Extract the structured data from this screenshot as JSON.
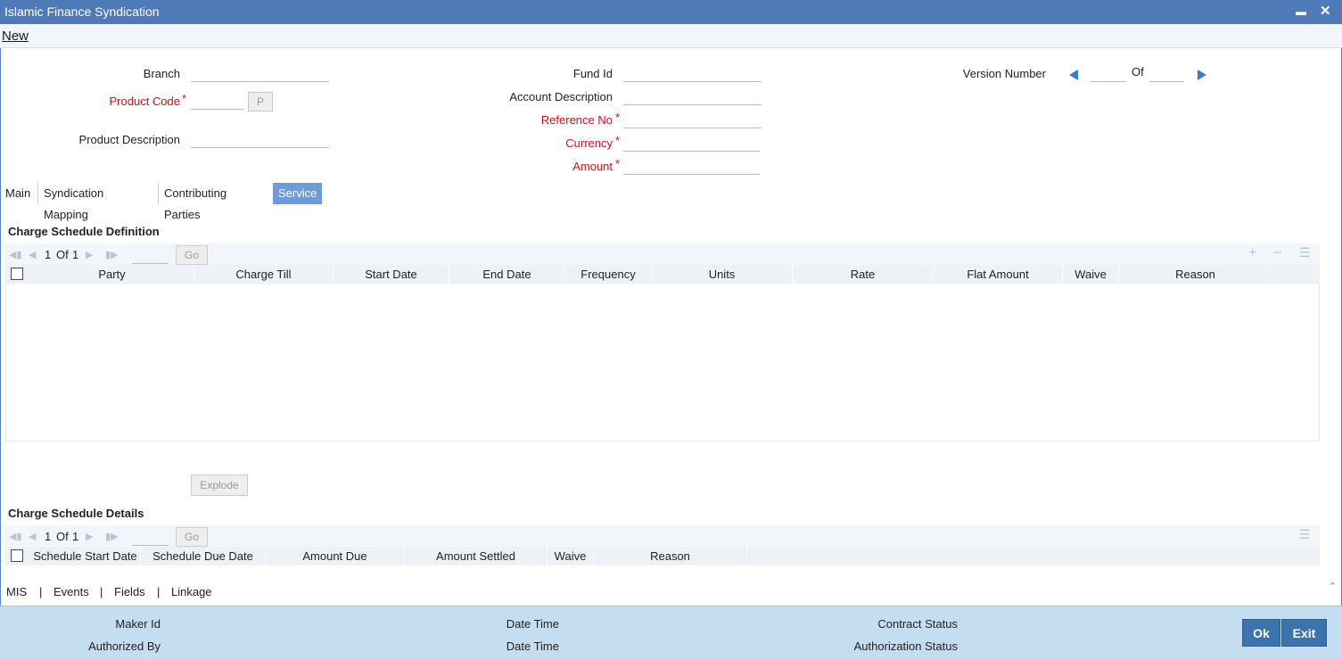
{
  "window": {
    "title": "Islamic Finance Syndication",
    "minimize_glyph": "▬",
    "close_glyph": "✕"
  },
  "menu": {
    "new_label": "New"
  },
  "header": {
    "branch_label": "Branch",
    "product_code_label": "Product Code",
    "product_code_button": "P",
    "product_description_label": "Product Description",
    "fund_id_label": "Fund Id",
    "account_description_label": "Account Description",
    "reference_no_label": "Reference No",
    "currency_label": "Currency",
    "amount_label": "Amount",
    "version_number_label": "Version Number",
    "version_of_label": "Of",
    "required_marker": "*"
  },
  "tabs": [
    "Main",
    "Syndication Mapping",
    "Contributing Parties",
    "Service Charge"
  ],
  "charge_schedule_definition": {
    "title": "Charge Schedule Definition",
    "pager": {
      "current": "1",
      "of_label": "Of",
      "total": "1",
      "go_label": "Go"
    },
    "columns": [
      "Party",
      "Charge Till",
      "Start Date",
      "End Date",
      "Frequency",
      "Units",
      "Rate",
      "Flat Amount",
      "Waive",
      "Reason"
    ],
    "rows": []
  },
  "explode_label": "Explode",
  "charge_schedule_details": {
    "title": "Charge Schedule Details",
    "pager": {
      "current": "1",
      "of_label": "Of",
      "total": "1",
      "go_label": "Go"
    },
    "columns": [
      "Schedule Start Date",
      "Schedule Due Date",
      "Amount Due",
      "Amount Settled",
      "Waive",
      "Reason"
    ]
  },
  "subnav": {
    "items": [
      "MIS",
      "Events",
      "Fields",
      "Linkage"
    ],
    "separator": "|"
  },
  "footer": {
    "maker_id_label": "Maker Id",
    "authorized_by_label": "Authorized By",
    "date_time_label": "Date Time",
    "contract_status_label": "Contract Status",
    "authorization_status_label": "Authorization Status",
    "ok_label": "Ok",
    "exit_label": "Exit"
  },
  "colors": {
    "titlebar": "#4f7ab8",
    "active_tab": "#6f9bd6",
    "required": "#c4161c",
    "footer": "#c5ddf0",
    "button": "#3b74ad"
  }
}
